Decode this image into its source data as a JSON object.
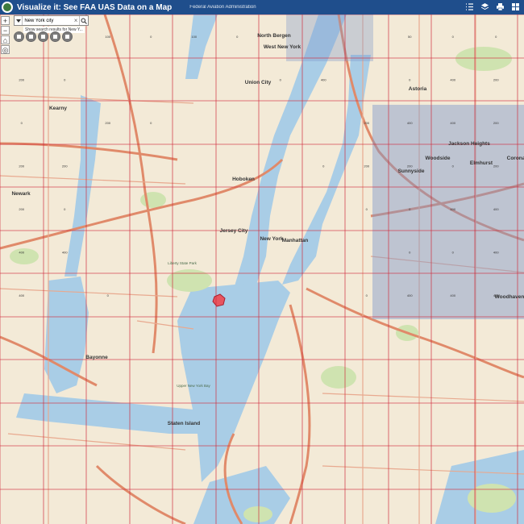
{
  "header": {
    "title": "Visualize it: See FAA UAS Data on a Map",
    "agency": "Federal Aviation Administration"
  },
  "search": {
    "value": "New York city",
    "clear_symbol": "×",
    "suggestion": "Show search results for New Y..."
  },
  "left_tools": [
    "+",
    "−",
    "⌂",
    "◎"
  ],
  "map": {
    "colors": {
      "land": "#f3ead7",
      "water": "#a9cde6",
      "park": "#cfe3b0",
      "highway": "#e08a6a",
      "grid_line": "#cf2a3c",
      "highlight": "#7e97c9"
    },
    "places": [
      {
        "name": "North Bergen"
      },
      {
        "name": "West New York"
      },
      {
        "name": "Union City"
      },
      {
        "name": "Kearny"
      },
      {
        "name": "Hoboken"
      },
      {
        "name": "Newark"
      },
      {
        "name": "Jersey City"
      },
      {
        "name": "New York"
      },
      {
        "name": "Manhattan"
      },
      {
        "name": "Astoria"
      },
      {
        "name": "Jackson Heights"
      },
      {
        "name": "Woodside"
      },
      {
        "name": "Sunnyside"
      },
      {
        "name": "Elmhurst"
      },
      {
        "name": "Corona"
      },
      {
        "name": "Woodhaven"
      },
      {
        "name": "Bayonne"
      },
      {
        "name": "Staten Island"
      },
      {
        "name": "Liberty State Park"
      },
      {
        "name": "Upper New York Bay"
      }
    ],
    "ceilings": [
      {
        "v": "100"
      },
      {
        "v": "0"
      },
      {
        "v": "100"
      },
      {
        "v": "0"
      },
      {
        "v": "50"
      },
      {
        "v": "0"
      },
      {
        "v": "0"
      },
      {
        "v": "200"
      },
      {
        "v": "0"
      },
      {
        "v": "0"
      },
      {
        "v": "400"
      },
      {
        "v": "0"
      },
      {
        "v": "400"
      },
      {
        "v": "200"
      },
      {
        "v": "0"
      },
      {
        "v": "200"
      },
      {
        "v": "0"
      },
      {
        "v": "200"
      },
      {
        "v": "400"
      },
      {
        "v": "400"
      },
      {
        "v": "200"
      },
      {
        "v": "200"
      },
      {
        "v": "200"
      },
      {
        "v": "0"
      },
      {
        "v": "200"
      },
      {
        "v": "200"
      },
      {
        "v": "0"
      },
      {
        "v": "200"
      },
      {
        "v": "200"
      },
      {
        "v": "0"
      },
      {
        "v": "0"
      },
      {
        "v": "0"
      },
      {
        "v": "400"
      },
      {
        "v": "400"
      },
      {
        "v": "400"
      },
      {
        "v": "400"
      },
      {
        "v": "0"
      },
      {
        "v": "0"
      },
      {
        "v": "400"
      },
      {
        "v": "400"
      },
      {
        "v": "0"
      },
      {
        "v": "400"
      },
      {
        "v": "400"
      },
      {
        "v": "400"
      },
      {
        "v": "0"
      }
    ]
  }
}
